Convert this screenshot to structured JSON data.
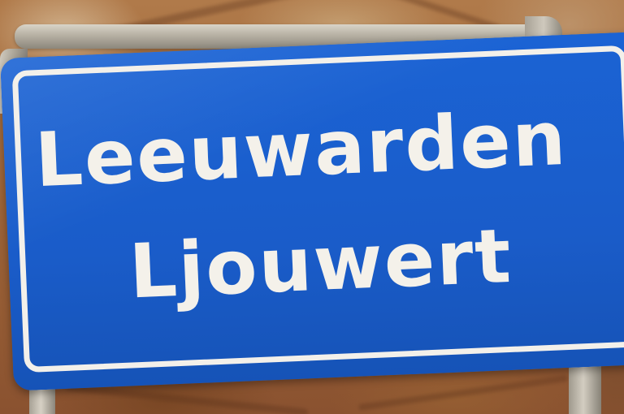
{
  "sign": {
    "primary_name": "Leeuwarden",
    "secondary_name": "Ljouwert"
  },
  "colors": {
    "sign_blue": "#1b63d4",
    "sign_text": "#f4f1ea",
    "frame_metal": "#b6b0a3"
  }
}
